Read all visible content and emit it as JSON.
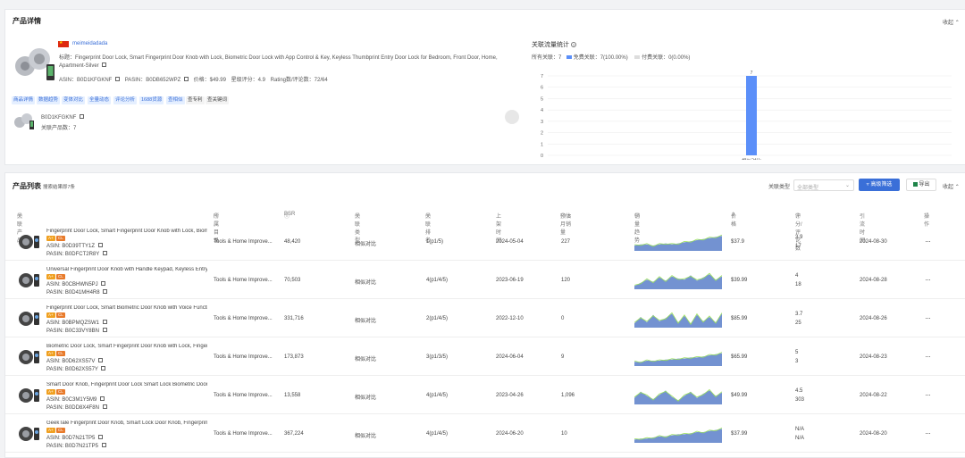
{
  "detail": {
    "title": "产品详情",
    "collapse_label": "收起",
    "seller": "meimeidadada",
    "product_title": "标题：Fingerprint Door Lock, Smart Fingerprint Door Knob with Lock, Biometric Door Lock with App Control & Key, Keyless Thumbprint Entry Door Lock for Bedroom, Front Door, Home, Apartment-Silver",
    "asin": "ASIN：B0D1KFGKNF",
    "pasin": "PASIN：B0DB652WPZ",
    "price": "价格：$49.99",
    "rating": "星级评分：4.9",
    "rating_count": "Rating数/评论数：72/64",
    "tags": [
      {
        "label": "商品详情",
        "style": "blue"
      },
      {
        "label": "数据趋势",
        "style": "blue"
      },
      {
        "label": "变体对比",
        "style": "blue"
      },
      {
        "label": "全量动态",
        "style": "blue"
      },
      {
        "label": "评论分析",
        "style": "blue"
      },
      {
        "label": "1688货源",
        "style": "blue"
      },
      {
        "label": "查相似",
        "style": "blue"
      },
      {
        "label": "查专利",
        "style": "grey"
      },
      {
        "label": "查关键词",
        "style": "grey"
      }
    ],
    "variant_asin": "B0D1KFGKNF",
    "variant_count": "关联产品数：7"
  },
  "traffic": {
    "title": "关联流量统计",
    "legend_all": "所有关联：7",
    "legend_free": "免费关联：7(100.00%)",
    "legend_paid": "付费关联：0(0.00%)",
    "free_color": "#5b8ff9",
    "paid_color": "#dddddd"
  },
  "chart_data": {
    "type": "bar",
    "categories": [
      "相似对比"
    ],
    "values": [
      7
    ],
    "data_labels": [
      "7"
    ],
    "ylim": [
      0,
      7
    ],
    "yticks": [
      "0",
      "1",
      "2",
      "3",
      "4",
      "5",
      "6",
      "7"
    ],
    "grid": true,
    "bar_color": "#5b8ff9"
  },
  "list": {
    "title": "产品列表",
    "subtitle": "搜索结果即7条",
    "filter_label": "关联类型",
    "filter_placeholder": "全部类型",
    "advanced_filter": "高级筛选",
    "export": "导出",
    "collapse_label": "收起",
    "headers": [
      "关联产品",
      "所属目录",
      "BSR",
      "关联类型",
      "关联排名",
      "上架时间",
      "预估月销量",
      "销量趋势",
      "价格",
      "评分/评论数",
      "引流时间",
      "操作"
    ],
    "rows": [
      {
        "title": "Fingerprint Door Lock, Smart Fingerprint Door Knob with Lock, Biometri...",
        "badge1": "A+",
        "badge2": "CL",
        "asin": "ASIN: B0D39TTY1Z",
        "pasin": "PASIN: B0DFCT2R8Y",
        "category": "Tools & Home Improve...",
        "bsr": "48,420",
        "type": "相似对比",
        "rank": "1(p1/5)",
        "date": "2024-05-04",
        "sales": "227",
        "trend": [
          5,
          6,
          6,
          5,
          6,
          7,
          6,
          7,
          8,
          9,
          10,
          11,
          12,
          13,
          14
        ],
        "price": "$37.9",
        "rating": "3.9",
        "reviews": "17",
        "lead_date": "2024-08-30"
      },
      {
        "title": "Universal Fingerprint Door Knob with Handle Keypad, Keyless Entry Chil...",
        "badge1": "A+",
        "badge2": "CL",
        "asin": "ASIN: B0CBHWN5PJ",
        "pasin": "PASIN: B0D41MH4R8",
        "category": "Tools & Home Improve...",
        "bsr": "70,503",
        "type": "相似对比",
        "rank": "4(p1/4/5)",
        "date": "2023-06-19",
        "sales": "120",
        "trend": [
          3,
          6,
          9,
          7,
          11,
          8,
          12,
          10,
          9,
          13,
          8,
          11,
          14,
          9,
          12
        ],
        "price": "$39.99",
        "rating": "4",
        "reviews": "18",
        "lead_date": "2024-08-28"
      },
      {
        "title": "Fingerprint Door Lock, Smart Biometric Door Knob with Voice Function...",
        "badge1": "A+",
        "badge2": "CL",
        "asin": "ASIN: B0BPMQZSW1",
        "pasin": "PASIN: B0C33VY8BN",
        "category": "Tools & Home Improve...",
        "bsr": "331,716",
        "type": "相似对比",
        "rank": "2(p1/4/5)",
        "date": "2022-12-10",
        "sales": "0",
        "trend": [
          4,
          10,
          5,
          12,
          6,
          9,
          13,
          5,
          11,
          4,
          12,
          6,
          10,
          5,
          13
        ],
        "price": "$85.99",
        "rating": "3.7",
        "reviews": "25",
        "lead_date": "2024-08-26"
      },
      {
        "title": "Biometric Door Lock, Smart Fingerprint Door Knob with Lock, Fingerpr...",
        "badge1": "A+",
        "badge2": "CL",
        "asin": "ASIN: B0D62XS57V",
        "pasin": "PASIN: B0D62XS57Y",
        "category": "Tools & Home Improve...",
        "bsr": "173,873",
        "type": "相似对比",
        "rank": "3(p1/3/5)",
        "date": "2024-06-04",
        "sales": "9",
        "trend": [
          4,
          4,
          5,
          5,
          5,
          6,
          6,
          7,
          7,
          8,
          8,
          9,
          10,
          11,
          12
        ],
        "price": "$65.99",
        "rating": "5",
        "reviews": "3",
        "lead_date": "2024-08-23"
      },
      {
        "title": "Smart Door Knob, Fingerprint Door Lock Smart Lock Biometric Door Lo...",
        "badge1": "A+",
        "badge2": "CL",
        "asin": "ASIN: B0C3M1Y5M9",
        "pasin": "PASIN: B0DD8X4F8N",
        "category": "Tools & Home Improve...",
        "bsr": "13,558",
        "type": "相似对比",
        "rank": "4(p1/4/5)",
        "date": "2023-04-26",
        "sales": "1,096",
        "trend": [
          6,
          12,
          8,
          5,
          9,
          13,
          7,
          4,
          8,
          12,
          6,
          10,
          13,
          8,
          11
        ],
        "price": "$49.99",
        "rating": "4.5",
        "reviews": "303",
        "lead_date": "2024-08-22"
      },
      {
        "title": "GeekTale Fingerprint Door Knob, Smart Lock Door Knob, Fingerprint Do...",
        "badge1": "A+",
        "badge2": "CL",
        "asin": "ASIN: B0D7N21TP5",
        "pasin": "PASIN: B0D7N21TP5",
        "category": "Tools & Home Improve...",
        "bsr": "367,224",
        "type": "相似对比",
        "rank": "4(p1/4/5)",
        "date": "2024-06-20",
        "sales": "10",
        "trend": [
          3,
          4,
          4,
          5,
          6,
          6,
          7,
          8,
          8,
          9,
          10,
          10,
          11,
          12,
          13
        ],
        "price": "$37.99",
        "rating": "N/A",
        "reviews": "N/A",
        "lead_date": "2024-08-20"
      }
    ]
  },
  "icons": {
    "flag": "china-flag-icon",
    "copy": "copy-icon",
    "info": "info-circle-icon",
    "chevron": "chevron-up-icon",
    "more": "more-dots-icon",
    "filter": "filter-icon"
  }
}
